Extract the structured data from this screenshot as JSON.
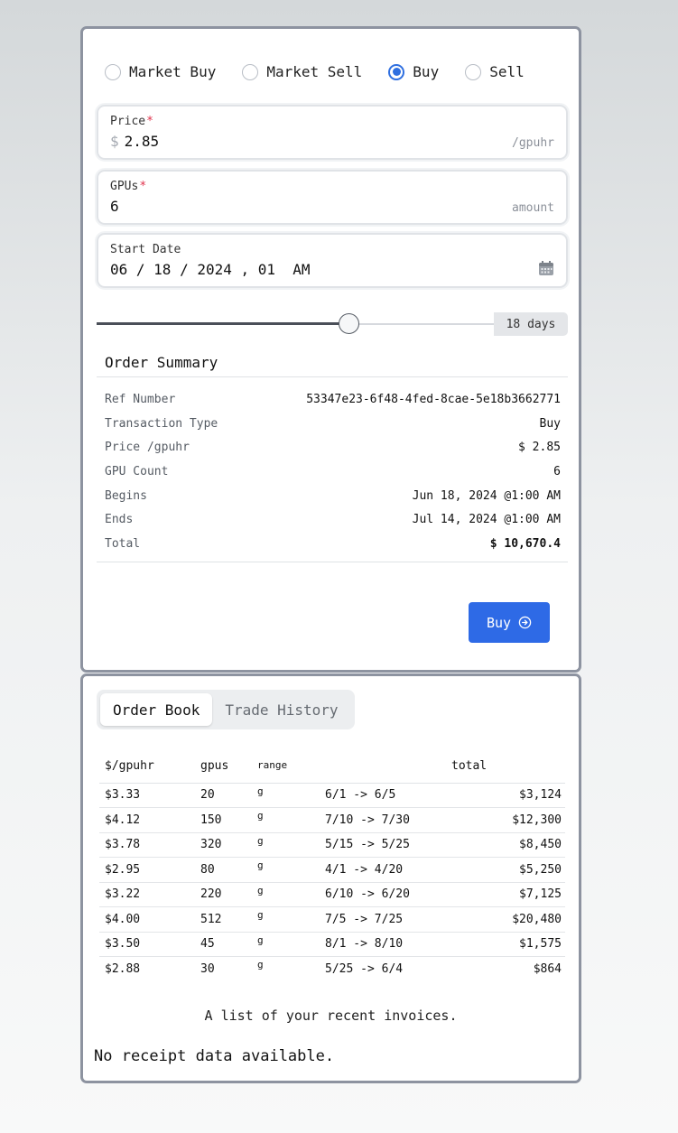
{
  "order_form": {
    "order_types": [
      {
        "label": "Market Buy",
        "checked": false
      },
      {
        "label": "Market Sell",
        "checked": false
      },
      {
        "label": "Buy",
        "checked": true
      },
      {
        "label": "Sell",
        "checked": false
      }
    ],
    "price": {
      "label": "Price",
      "required_mark": "*",
      "prefix": "$",
      "value": "2.85",
      "suffix": "/gpuhr"
    },
    "gpus": {
      "label": "GPUs",
      "required_mark": "*",
      "value": "6",
      "suffix": "amount"
    },
    "start_date": {
      "label": "Start Date",
      "value": "06 / 18 / 2024 , 01  AM",
      "icon": "calendar-icon"
    },
    "duration": {
      "level_fraction": 0.634,
      "badge": "18 days"
    }
  },
  "summary": {
    "title": "Order Summary",
    "rows": [
      {
        "key": "Ref Number",
        "value": "53347e23-6f48-4fed-8cae-5e18b3662771"
      },
      {
        "key": "Transaction Type",
        "value": "Buy"
      },
      {
        "key": "Price /gpuhr",
        "value": "$ 2.85"
      },
      {
        "key": "GPU Count",
        "value": "6"
      },
      {
        "key": "Begins",
        "value": "Jun 18, 2024 @1:00 AM"
      },
      {
        "key": "Ends",
        "value": "Jul 14, 2024 @1:00 AM"
      },
      {
        "key": "Total",
        "value": "$ 10,670.4"
      }
    ],
    "submit_label": "Buy",
    "submit_icon": "arrow-circle-right-icon"
  },
  "book": {
    "tabs": [
      {
        "label": "Order Book",
        "active": true
      },
      {
        "label": "Trade History",
        "active": false
      }
    ],
    "headers": {
      "price": "$/gpuhr",
      "gpus": "gpus",
      "range": "range",
      "total": "total"
    },
    "rows": [
      {
        "price": "$3.33",
        "gpus": "20",
        "unit": "g",
        "range": "6/1 -> 6/5",
        "total": "$3,124"
      },
      {
        "price": "$4.12",
        "gpus": "150",
        "unit": "g",
        "range": "7/10 -> 7/30",
        "total": "$12,300"
      },
      {
        "price": "$3.78",
        "gpus": "320",
        "unit": "g",
        "range": "5/15 -> 5/25",
        "total": "$8,450"
      },
      {
        "price": "$2.95",
        "gpus": "80",
        "unit": "g",
        "range": "4/1 -> 4/20",
        "total": "$5,250"
      },
      {
        "price": "$3.22",
        "gpus": "220",
        "unit": "g",
        "range": "6/10 -> 6/20",
        "total": "$7,125"
      },
      {
        "price": "$4.00",
        "gpus": "512",
        "unit": "g",
        "range": "7/5 -> 7/25",
        "total": "$20,480"
      },
      {
        "price": "$3.50",
        "gpus": "45",
        "unit": "g",
        "range": "8/1 -> 8/10",
        "total": "$1,575"
      },
      {
        "price": "$2.88",
        "gpus": "30",
        "unit": "g",
        "range": "5/25 -> 6/4",
        "total": "$864"
      }
    ],
    "caption": "A list of your recent invoices.",
    "empty_note": "No receipt data available."
  },
  "colors": {
    "accent": "#2e6ae6",
    "required": "#e0314b",
    "card_border": "#8d93a0"
  }
}
